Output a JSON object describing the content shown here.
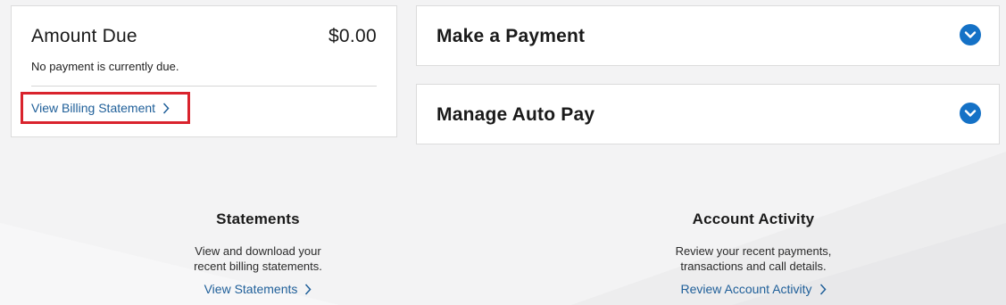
{
  "amount_due": {
    "title": "Amount Due",
    "amount": "$0.00",
    "note": "No payment is currently due.",
    "link_label": "View Billing Statement",
    "link_icon": "chevron-right-icon",
    "highlight_color": "#d9232d"
  },
  "make_payment": {
    "title": "Make a Payment",
    "toggle_icon": "chevron-down-icon"
  },
  "auto_pay": {
    "title": "Manage Auto Pay",
    "toggle_icon": "chevron-down-icon"
  },
  "statements": {
    "title": "Statements",
    "desc_line1": "View and download your",
    "desc_line2": "recent billing statements.",
    "link_label": "View Statements"
  },
  "account_activity": {
    "title": "Account Activity",
    "desc_line1": "Review your recent payments,",
    "desc_line2": "transactions and call details.",
    "link_label": "Review Account Activity"
  },
  "colors": {
    "link": "#1f5f99",
    "accent": "#1471c6",
    "background": "#f3f3f4"
  }
}
